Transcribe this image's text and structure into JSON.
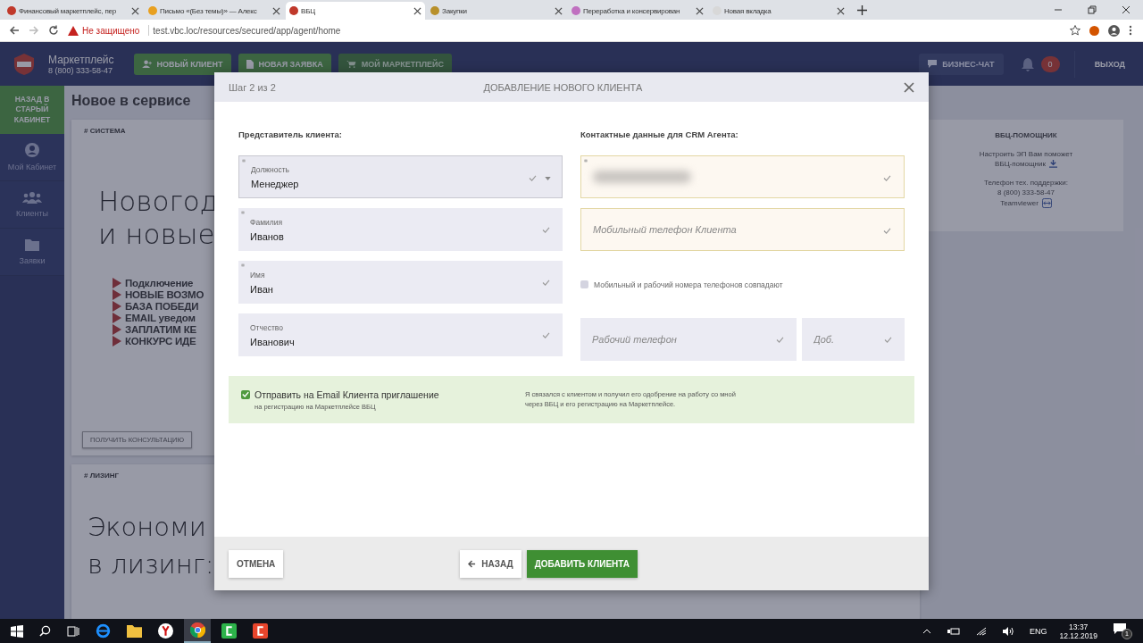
{
  "browser": {
    "tabs": [
      {
        "title": "Финансовый маркетплейс, пер",
        "selected": false,
        "color": "#c0392b"
      },
      {
        "title": "Письмо «(Без темы)» — Алекс",
        "selected": false,
        "color": "#e8a020"
      },
      {
        "title": "ВБЦ",
        "selected": true,
        "color": "#c0392b"
      },
      {
        "title": "Закупки",
        "selected": false,
        "color": "#b8902a"
      },
      {
        "title": "Переработка и консервирован",
        "selected": false,
        "color": "#c070c0"
      },
      {
        "title": "Новая вкладка",
        "selected": false,
        "color": "#d8d8d8"
      }
    ],
    "address": {
      "security": "Не защищено",
      "url": "test.vbc.loc/resources/secured/app/agent/home"
    }
  },
  "header": {
    "brand": "Маркетплейс",
    "phone": "8 (800) 333-58-47",
    "buttons": [
      {
        "label": "НОВЫЙ КЛИЕНТ",
        "kind": "user"
      },
      {
        "label": "НОВАЯ ЗАЯВКА",
        "kind": "doc"
      },
      {
        "label": "МОЙ МАРКЕТПЛЕЙС",
        "kind": "cart"
      }
    ],
    "chat": "БИЗНЕС-ЧАТ",
    "notifications": "0",
    "logout": "ВЫХОД"
  },
  "sidebar": {
    "back": "НАЗАД В СТАРЫЙ КАБИНЕТ",
    "items": [
      {
        "label": "Мой Кабинет",
        "kind": "user"
      },
      {
        "label": "Клиенты",
        "kind": "group"
      },
      {
        "label": "Заявки",
        "kind": "folder"
      }
    ]
  },
  "content": {
    "title": "Новое в сервисе",
    "cards": [
      {
        "tag": "# СИСТЕМА",
        "headline": [
          "Новогод",
          "и новые"
        ],
        "bullets": [
          "Подключение",
          "НОВЫЕ ВОЗМО",
          "БАЗА ПОБЕДИ",
          "EMAIL уведом",
          "ЗАПЛАТИМ КЕ",
          "КОНКУРС ИДЕ"
        ],
        "button": "ПОЛУЧИТЬ КОНСУЛЬТАЦИЮ"
      },
      {
        "tag": "# ЛИЗИНГ",
        "headline": [
          "Экономи",
          "в лизинг:"
        ]
      }
    ],
    "helper": {
      "title": "ВБЦ-ПОМОЩНИК",
      "text": "Настроить ЭП Вам поможет",
      "link": "ВБЦ-помощник",
      "support": "Телефон тех. поддержки:",
      "phone": "8 (800) 333-58-47",
      "teamviewer": "Teamviewer"
    }
  },
  "modal": {
    "step": "Шаг 2 из 2",
    "title": "ДОБАВЛЕНИЕ НОВОГО КЛИЕНТА",
    "left": {
      "heading": "Представитель клиента:",
      "fields": [
        {
          "label": "Должность",
          "value": "Менеджер",
          "kind": "select",
          "required": true
        },
        {
          "label": "Фамилия",
          "value": "Иванов",
          "kind": "text",
          "required": true
        },
        {
          "label": "Имя",
          "value": "Иван",
          "kind": "text",
          "required": true
        },
        {
          "label": "Отчество",
          "value": "Иванович",
          "kind": "text",
          "required": false
        }
      ]
    },
    "right": {
      "heading": "Контактные данные для CRM Агента:",
      "email": {
        "kind": "blurred",
        "required": true
      },
      "mobile": {
        "placeholder": "Мобильный телефон Клиента"
      },
      "same_numbers": {
        "label": "Мобильный и рабочий номера телефонов совпадают",
        "checked": false
      },
      "work_phone": {
        "placeholder": "Рабочий телефон"
      },
      "extension": {
        "placeholder": "Доб."
      }
    },
    "invite": {
      "checked": true,
      "label": "Отправить на Email Клиента приглашение",
      "sublabel": "на регистрацию на Маркетплейсе ВБЦ",
      "note": "Я связался с клиентом и получил его одобрение на работу со мной через ВБЦ и его регистрацию на Маркетплейсе."
    },
    "buttons": {
      "cancel": "ОТМЕНА",
      "back": "НАЗАД",
      "submit": "ДОБАВИТЬ КЛИЕНТА"
    }
  },
  "taskbar": {
    "language": "ENG",
    "time": "13:37",
    "date": "12.12.2019",
    "notifications": "1"
  }
}
